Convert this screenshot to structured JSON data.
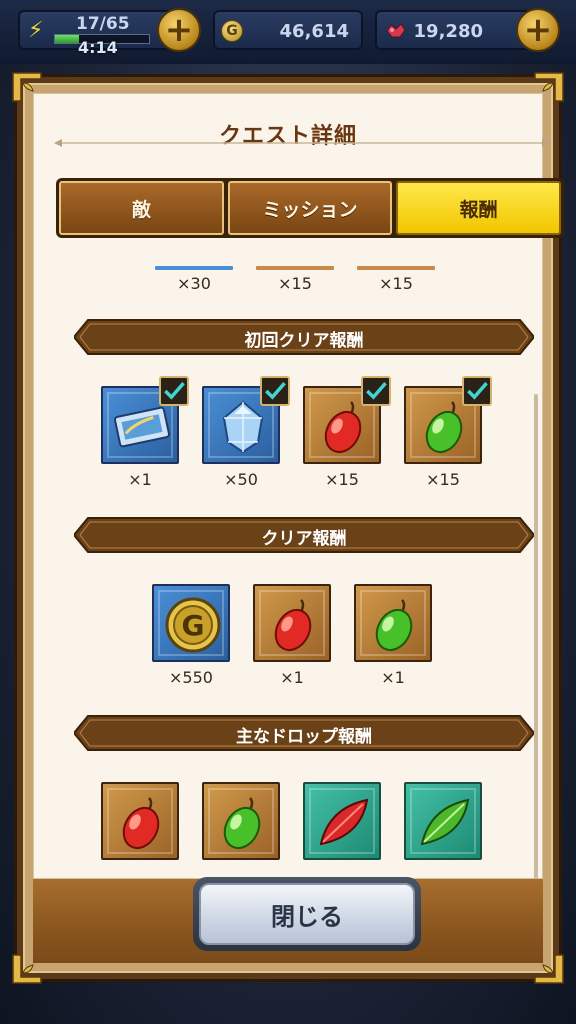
{
  "status_bar": {
    "stamina": "17/65",
    "stamina_fraction": 0.26,
    "stamina_timer": "4:14",
    "gold": "46,614",
    "gems": "19,280",
    "gold_icon_letter": "G"
  },
  "dialog": {
    "title": "クエスト詳細",
    "tabs": [
      {
        "label": "敵",
        "active": false
      },
      {
        "label": "ミッション",
        "active": false
      },
      {
        "label": "報酬",
        "active": true
      }
    ],
    "partial_row": [
      {
        "count": "×30",
        "color": "#4a8fd6"
      },
      {
        "count": "×15",
        "color": "#c88a4a"
      },
      {
        "count": "×15",
        "color": "#c88a4a"
      }
    ],
    "sections": {
      "first_clear": {
        "label": "初回クリア報酬",
        "items": [
          {
            "icon": "ticket-icon",
            "frame": "blue",
            "count": "×1",
            "checked": true
          },
          {
            "icon": "crystal-icon",
            "frame": "blue",
            "count": "×50",
            "checked": true
          },
          {
            "icon": "red-fruit-icon",
            "frame": "brown",
            "count": "×15",
            "checked": true
          },
          {
            "icon": "green-fruit-icon",
            "frame": "brown",
            "count": "×15",
            "checked": true
          }
        ]
      },
      "clear": {
        "label": "クリア報酬",
        "items": [
          {
            "icon": "gold-coin-icon",
            "frame": "blue",
            "count": "×550"
          },
          {
            "icon": "red-fruit-icon",
            "frame": "brown",
            "count": "×1"
          },
          {
            "icon": "green-fruit-icon",
            "frame": "brown",
            "count": "×1"
          }
        ]
      },
      "drops": {
        "label": "主なドロップ報酬",
        "items": [
          {
            "icon": "red-fruit-icon",
            "frame": "brown"
          },
          {
            "icon": "green-fruit-icon",
            "frame": "brown"
          },
          {
            "icon": "red-leaf-icon",
            "frame": "teal"
          },
          {
            "icon": "green-leaf-icon",
            "frame": "teal"
          }
        ]
      }
    },
    "close_label": "閉じる"
  },
  "colors": {
    "tab_active": "#f7d21a",
    "banner": "#6b4218",
    "paper": "#fbf4ea"
  }
}
